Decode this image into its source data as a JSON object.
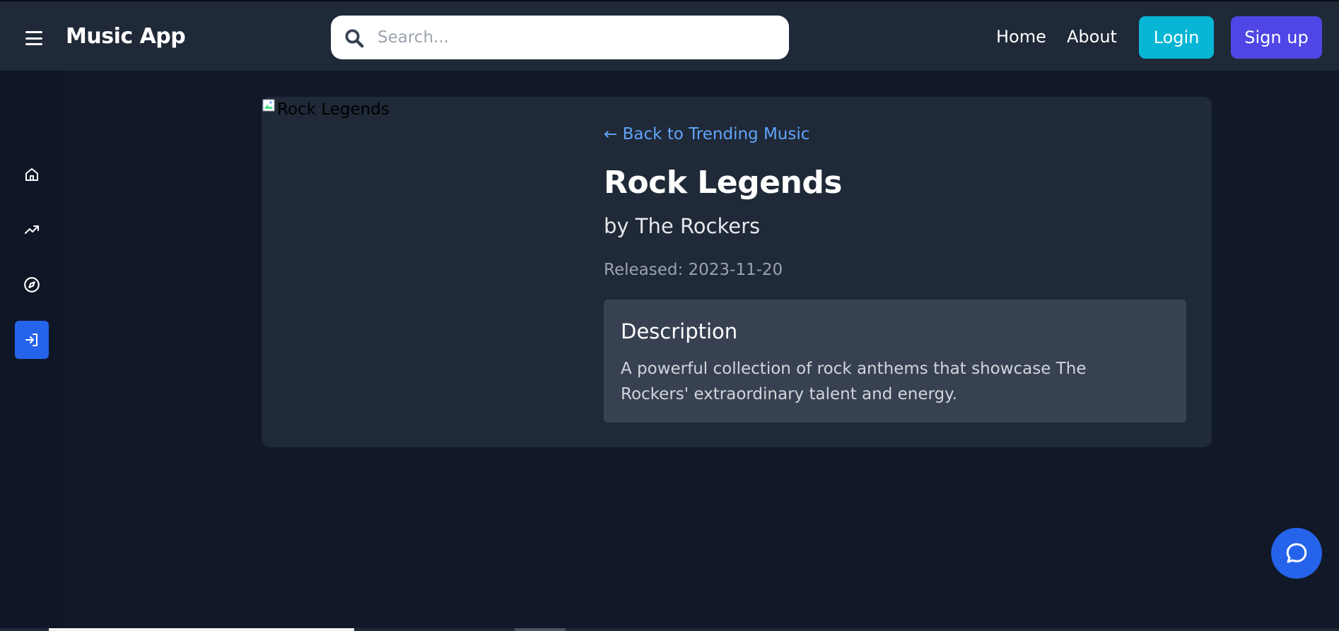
{
  "header": {
    "brand": "Music App",
    "search_placeholder": "Search...",
    "nav": {
      "home": "Home",
      "about": "About"
    },
    "login_label": "Login",
    "signup_label": "Sign up"
  },
  "sidebar": {
    "items": [
      {
        "icon": "home-icon"
      },
      {
        "icon": "trending-icon"
      },
      {
        "icon": "compass-icon"
      },
      {
        "icon": "login-icon",
        "active": true
      }
    ]
  },
  "album": {
    "image_alt": "Rock Legends",
    "back_link": "← Back to Trending Music",
    "title": "Rock Legends",
    "artist": "by The Rockers",
    "released": "Released: 2023-11-20",
    "description_heading": "Description",
    "description": "A powerful collection of rock anthems that showcase The Rockers' extraordinary talent and energy."
  },
  "colors": {
    "background": "#111827",
    "header": "#1f2937",
    "card": "#1f2937",
    "description_box": "#374151",
    "login_button": "#06b6d4",
    "signup_button": "#4f46e5",
    "active_sidebar": "#2563eb",
    "link": "#60a5fa",
    "chat_button": "#2563eb"
  }
}
